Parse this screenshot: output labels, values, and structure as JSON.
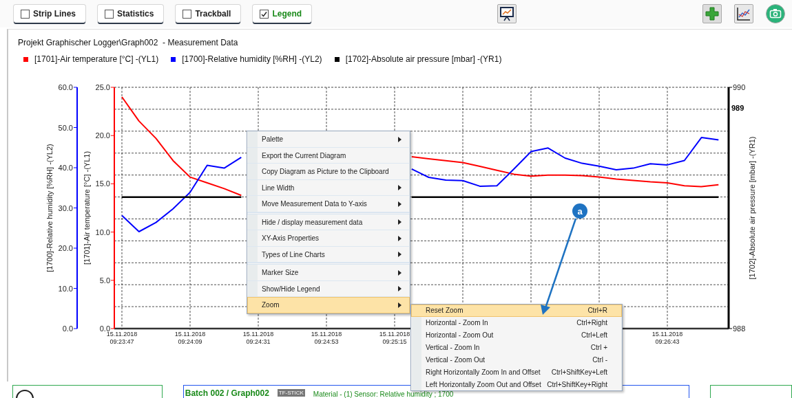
{
  "toolbar": {
    "toggles": [
      {
        "label": "Strip Lines",
        "checked": false
      },
      {
        "label": "Statistics",
        "checked": false
      },
      {
        "label": "Trackball",
        "checked": false
      },
      {
        "label": "Legend",
        "checked": true
      }
    ]
  },
  "graph": {
    "title": "Projekt Graphischer Logger\\Graph002  - Measurement Data",
    "legend": [
      {
        "label": "[1701]-Air temperature [°C] -(YL1)",
        "color": "#ff0000"
      },
      {
        "label": "[1700]-Relative humidity [%RH] -(YL2)",
        "color": "#0000ff"
      },
      {
        "label": "[1702]-Absolute air pressure [mbar] -(YR1)",
        "color": "#000000"
      }
    ],
    "chart_data": {
      "type": "line",
      "grid": true,
      "categories": [
        "15.11.2018\n09:23:47",
        null,
        null,
        null,
        "15.11.2018\n09:24:09",
        null,
        null,
        null,
        "15.11.2018\n09:24:31",
        null,
        null,
        null,
        "15.11.2018\n09:24:53",
        null,
        null,
        null,
        "15.11.2018\n09:25:15",
        null,
        null,
        null,
        null,
        null,
        null,
        null,
        null,
        null,
        null,
        null,
        null,
        null,
        null,
        null,
        "15.11.2018\n09:26:43",
        null,
        null,
        null
      ],
      "ylabel": "[1701]-Air temperature [°C] -(YL1)",
      "ylim": [
        0,
        25
      ],
      "yticks": [
        {
          "value": 0,
          "label": "0.0"
        },
        {
          "value": 5,
          "label": "5.0"
        },
        {
          "value": 10,
          "label": "10.0"
        },
        {
          "value": 15,
          "label": "15.0"
        },
        {
          "value": 20,
          "label": "20.0"
        },
        {
          "value": 25,
          "label": "25.0"
        }
      ],
      "y2label": "[1700]-Relative humidity [%RH] -(YL2)",
      "y2lim": [
        0,
        60
      ],
      "y2ticks": [
        {
          "value": 0,
          "label": "0.0"
        },
        {
          "value": 10,
          "label": "10.0"
        },
        {
          "value": 20,
          "label": "20.0"
        },
        {
          "value": 30,
          "label": "30.0"
        },
        {
          "value": 40,
          "label": "40.0"
        },
        {
          "value": 50,
          "label": "50.0"
        },
        {
          "value": 60,
          "label": "60.0"
        }
      ],
      "y3label": "[1702]-Absolute air pressure [mbar] -(YR1)",
      "y3lim": [
        988,
        990
      ],
      "y3ticks": [
        {
          "value": 988,
          "label": "988"
        },
        {
          "value": 990,
          "label": "990"
        }
      ],
      "series": [
        {
          "color": "#ff0000",
          "values": [
            24.0,
            21.5,
            19.7,
            17.4,
            15.7,
            15.1,
            14.5,
            13.8,
            null,
            null,
            null,
            null,
            null,
            null,
            null,
            null,
            null,
            17.8,
            17.6,
            17.4,
            17.2,
            16.8,
            16.4,
            16.0,
            15.8,
            15.9,
            15.9,
            15.85,
            15.7,
            15.5,
            15.35,
            15.2,
            15.1,
            14.8,
            14.7,
            14.9
          ]
        },
        {
          "color": "#0000ff",
          "axis": "y2",
          "values": [
            28.1,
            24.1,
            26.4,
            29.8,
            33.9,
            40.6,
            39.9,
            42.6,
            null,
            null,
            null,
            null,
            null,
            null,
            null,
            null,
            null,
            39.7,
            37.6,
            36.9,
            36.8,
            35.4,
            35.5,
            39.7,
            44.0,
            44.9,
            42.4,
            41.1,
            40.4,
            39.5,
            39.9,
            41.0,
            40.7,
            41.8,
            47.5,
            46.9
          ]
        },
        {
          "color": "#000000",
          "axis": "y3",
          "values": [
            989.09,
            989.09,
            989.09,
            989.09,
            989.09,
            989.09,
            989.09,
            989.09,
            null,
            null,
            null,
            null,
            null,
            null,
            null,
            null,
            null,
            989.09,
            989.09,
            989.09,
            989.09,
            989.09,
            989.09,
            989.09,
            989.09,
            989.09,
            989.09,
            989.09,
            989.09,
            989.09,
            989.09,
            989.09,
            989.09,
            989.09,
            989.09,
            989.09
          ]
        }
      ],
      "annotations": [
        "989"
      ]
    }
  },
  "context_menu": {
    "groups": [
      [
        {
          "label": "Palette",
          "submenu": true,
          "selected": false
        },
        {
          "label": "Export the Current Diagram",
          "submenu": false,
          "selected": false
        },
        {
          "label": "Copy Diagram as Picture to the Clipboard",
          "submenu": false,
          "selected": false
        },
        {
          "label": "Line Width",
          "submenu": true,
          "selected": false
        },
        {
          "label": "Move Measurement Data to Y-axis",
          "submenu": true,
          "selected": false
        }
      ],
      [
        {
          "label": "Hide / display measurement data",
          "submenu": true,
          "selected": false
        },
        {
          "label": "XY-Axis Properties",
          "submenu": true,
          "selected": false
        },
        {
          "label": "Types of Line Charts",
          "submenu": true,
          "selected": false
        }
      ],
      [
        {
          "label": "Marker Size",
          "submenu": true,
          "selected": false
        },
        {
          "label": "Show/Hide Legend",
          "submenu": true,
          "selected": false
        },
        {
          "label": "Zoom",
          "submenu": true,
          "selected": true
        }
      ]
    ]
  },
  "zoom_submenu": [
    {
      "label": "Reset Zoom",
      "shortcut": "Ctrl+R",
      "selected": true
    },
    {
      "label": "Horizontal - Zoom In",
      "shortcut": "Ctrl+Right",
      "selected": false
    },
    {
      "label": "Horizontal - Zoom Out",
      "shortcut": "Ctrl+Left",
      "selected": false
    },
    {
      "label": "Vertical - Zoom In",
      "shortcut": "Ctrl +",
      "selected": false
    },
    {
      "label": "Vertical - Zoom Out",
      "shortcut": "Ctrl -",
      "selected": false
    },
    {
      "label": "Right Horizontally Zoom In and Offset",
      "shortcut": "Ctrl+ShiftKey+Left",
      "selected": false
    },
    {
      "label": "Left Horizontally Zoom Out and Offset",
      "shortcut": "Ctrl+ShiftKey+Right",
      "selected": false
    }
  ],
  "callout": {
    "label": "a"
  },
  "bottom_panel": {
    "title": "Batch 002 / Graph002",
    "badge": "TF-STICK",
    "info": "Material - (1) Sensor: Relative humidity ; 1700"
  }
}
